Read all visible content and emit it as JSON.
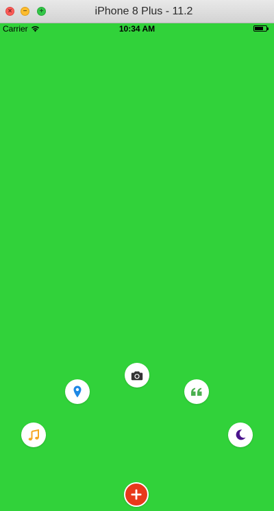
{
  "window": {
    "title": "iPhone 8 Plus - 11.2",
    "controls": {
      "close_glyph": "×",
      "minimize_glyph": "−",
      "zoom_glyph": "+"
    }
  },
  "status_bar": {
    "carrier": "Carrier",
    "time": "10:34 AM",
    "wifi_icon": "wifi-icon",
    "battery_icon": "battery-icon"
  },
  "screen": {
    "background_color": "#31d23a"
  },
  "radial_menu": {
    "items": [
      {
        "name": "camera",
        "icon": "camera-icon",
        "color": "#333333"
      },
      {
        "name": "location",
        "icon": "map-pin-icon",
        "color": "#1e88e5"
      },
      {
        "name": "quote",
        "icon": "quote-icon",
        "color": "#4caf50"
      },
      {
        "name": "music",
        "icon": "music-note-icon",
        "color": "#f5a623"
      },
      {
        "name": "moon",
        "icon": "moon-icon",
        "color": "#4a148c"
      }
    ],
    "main_button": {
      "icon": "plus-icon",
      "color": "#e8391b"
    }
  }
}
